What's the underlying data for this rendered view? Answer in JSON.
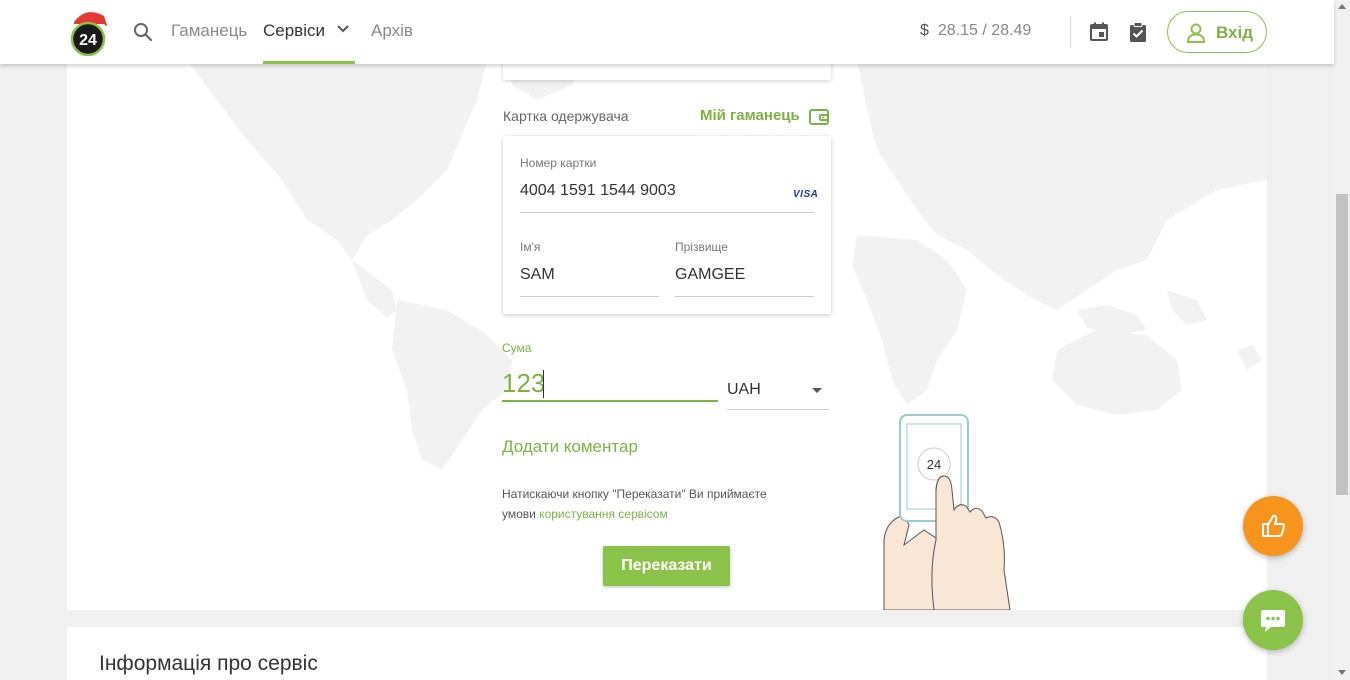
{
  "header": {
    "nav": {
      "wallet": "Гаманець",
      "services": "Сервіси",
      "archive": "Архів"
    },
    "logo_text": "24",
    "rate": {
      "symbol": "$",
      "value": "28.15 / 28.49"
    },
    "login_label": "Вхід"
  },
  "form": {
    "recipient_card_label": "Картка одержувача",
    "my_wallet_label": "Мій гаманець",
    "card_number_label": "Номер картки",
    "card_number_value": "4004 1591 1544 9003",
    "card_brand": "VISA",
    "first_name_label": "Ім'я",
    "first_name_value": "SAM",
    "last_name_label": "Прізвище",
    "last_name_value": "GAMGEE",
    "amount_label": "Сума",
    "amount_value": "123",
    "currency": "UAH",
    "add_comment": "Додати коментар",
    "terms_text": "Натискаючи кнопку \"Переказати\" Ви приймаєте умови ",
    "terms_link": "користування сервісом",
    "submit_label": "Переказати"
  },
  "illustration": {
    "phone_badge": "24"
  },
  "info": {
    "title": "Інформація про сервіс"
  },
  "colors": {
    "accent": "#8bc34a",
    "accent_text": "#7cb342",
    "like_button": "#f7941d"
  },
  "icons": [
    "search-icon",
    "chevron-down-icon",
    "calendar-icon",
    "clipboard-check-icon",
    "user-icon",
    "wallet-icon",
    "thumbs-up-icon",
    "chat-icon"
  ]
}
